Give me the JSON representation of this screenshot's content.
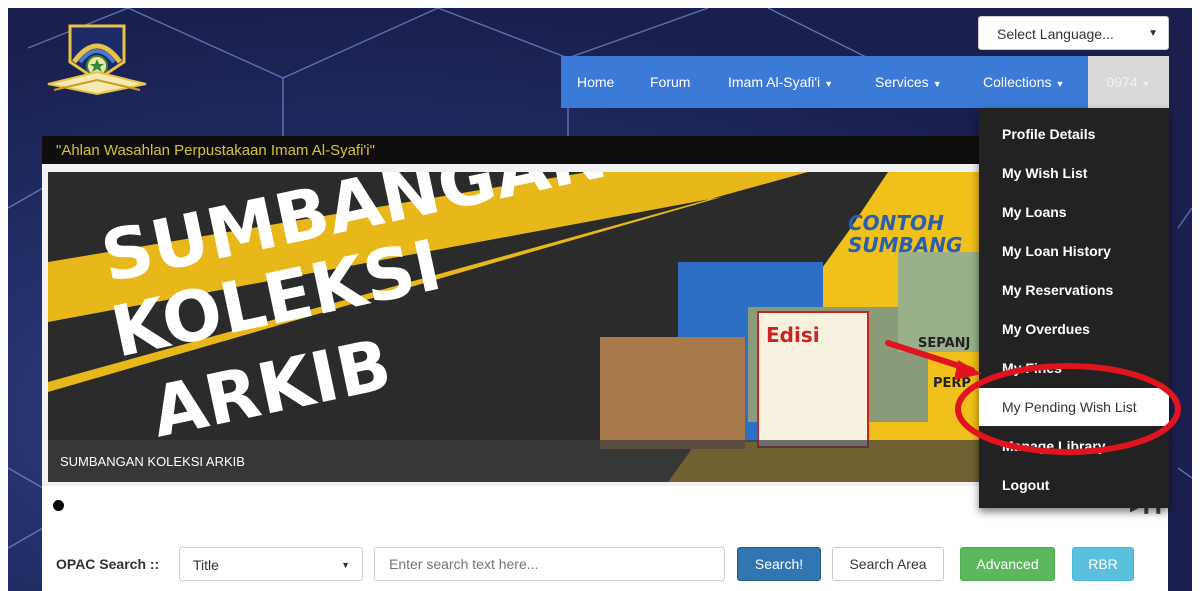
{
  "header": {
    "language_select": "Select Language...",
    "nav": [
      "Home",
      "Forum",
      "Imam Al-Syafi'i",
      "Services",
      "Collections"
    ],
    "user_id": "0974"
  },
  "tagline": "\"Ahlan Wasahlan Perpustakaan Imam Al-Syafi'i\"",
  "banner": {
    "title_lines": [
      "SUMBANGAN",
      "KOLEKSI",
      "ARKIB"
    ],
    "side_text": [
      "CONTOH",
      "SUMBANG"
    ],
    "fragments": [
      "SEPANJ",
      "PERP",
      "Edisi"
    ],
    "caption": "SUMBANGAN KOLEKSI ARKIB"
  },
  "user_menu": {
    "items": [
      "Profile Details",
      "My Wish List",
      "My Loans",
      "My Loan History",
      "My Reservations",
      "My Overdues",
      "My Fines",
      "My Pending Wish List",
      "Manage Library",
      "Logout"
    ]
  },
  "search": {
    "label": "OPAC Search ::",
    "field_selected": "Title",
    "placeholder": "Enter search text here...",
    "buttons": {
      "search": "Search!",
      "search_area": "Search Area",
      "advanced": "Advanced",
      "rbr": "RBR"
    }
  },
  "colors": {
    "navbar": "#3b7ad6",
    "tagline_text": "#d4c238",
    "banner_yellow": "#f2c01a",
    "dropdown_bg": "#222222",
    "annotation_red": "#e0141e",
    "btn_search": "#3276b1",
    "btn_advanced": "#5cb85c",
    "btn_rbr": "#5bc0de"
  }
}
